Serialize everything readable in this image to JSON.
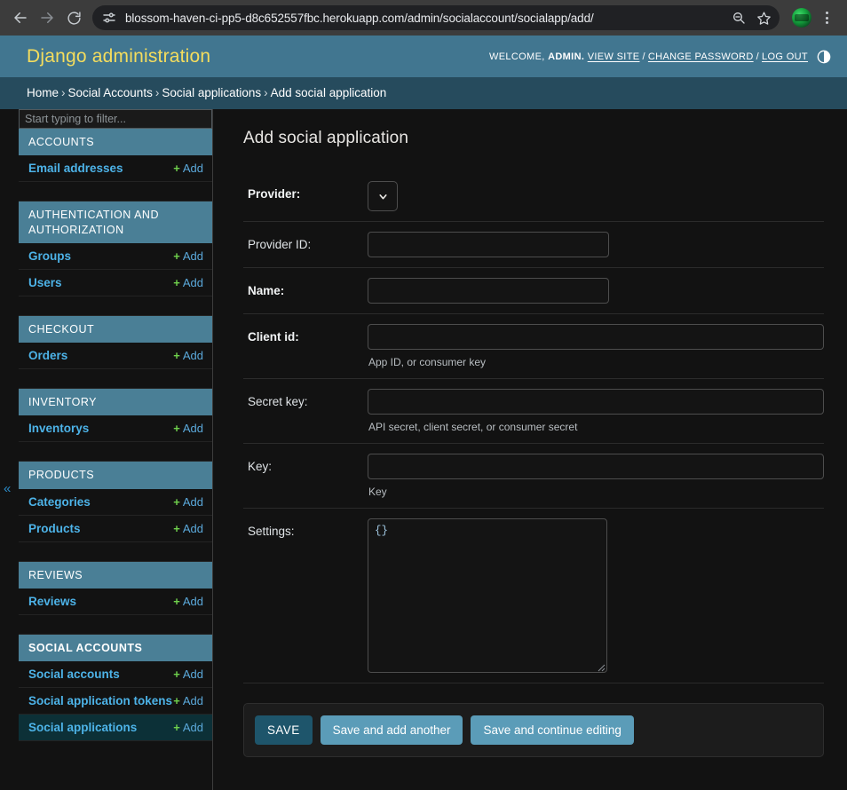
{
  "browser": {
    "url": "blossom-haven-ci-pp5-d8c652557fbc.herokuapp.com/admin/socialaccount/socialapp/add/",
    "back_icon": "back-arrow-icon",
    "forward_icon": "forward-arrow-icon",
    "reload_icon": "reload-icon",
    "site_info_icon": "site-settings-icon",
    "zoom_icon": "zoom-out-icon",
    "bookmark_icon": "star-icon",
    "profile_icon": "profile-avatar",
    "menu_icon": "kebab-menu-icon"
  },
  "header": {
    "brand": "Django administration",
    "welcome_prefix": "WELCOME,",
    "username": "ADMIN.",
    "view_site": "VIEW SITE",
    "change_password": "CHANGE PASSWORD",
    "log_out": "LOG OUT",
    "separator": "/",
    "theme_toggle_icon": "theme-toggle-icon",
    "bg_color": "#417690",
    "brand_color": "#f5dd5d"
  },
  "breadcrumbs": {
    "items": [
      "Home",
      "Social Accounts",
      "Social applications",
      "Add social application"
    ],
    "separator": "›",
    "bg_color": "#264b5d"
  },
  "sidebar": {
    "filter_placeholder": "Start typing to filter...",
    "filter_value": "",
    "collapse_icon": "«",
    "add_label": "Add",
    "plus_glyph": "+",
    "groups": [
      {
        "caption": "ACCOUNTS",
        "bold": false,
        "models": [
          {
            "label": "Email addresses",
            "add": "Add",
            "current": false
          }
        ]
      },
      {
        "caption": "AUTHENTICATION AND AUTHORIZATION",
        "bold": false,
        "models": [
          {
            "label": "Groups",
            "add": "Add",
            "current": false
          },
          {
            "label": "Users",
            "add": "Add",
            "current": false
          }
        ]
      },
      {
        "caption": "CHECKOUT",
        "bold": false,
        "models": [
          {
            "label": "Orders",
            "add": "Add",
            "current": false
          }
        ]
      },
      {
        "caption": "INVENTORY",
        "bold": false,
        "models": [
          {
            "label": "Inventorys",
            "add": "Add",
            "current": false
          }
        ]
      },
      {
        "caption": "PRODUCTS",
        "bold": false,
        "models": [
          {
            "label": "Categories",
            "add": "Add",
            "current": false
          },
          {
            "label": "Products",
            "add": "Add",
            "current": false
          }
        ]
      },
      {
        "caption": "REVIEWS",
        "bold": false,
        "models": [
          {
            "label": "Reviews",
            "add": "Add",
            "current": false
          }
        ]
      },
      {
        "caption": "SOCIAL ACCOUNTS",
        "bold": true,
        "models": [
          {
            "label": "Social accounts",
            "add": "Add",
            "current": false
          },
          {
            "label": "Social application tokens",
            "add": "Add",
            "current": false
          },
          {
            "label": "Social applications",
            "add": "Add",
            "current": true
          }
        ]
      }
    ],
    "header_bg": "#4a7f96",
    "current_bg": "#0c3037",
    "link_color": "#4db3e8",
    "plus_color": "#6fd04c"
  },
  "main": {
    "title": "Add social application",
    "fields": [
      {
        "label": "Provider:",
        "required": true,
        "control": "select",
        "value": "",
        "help": "",
        "chevron_icon": "chevron-down-icon"
      },
      {
        "label": "Provider ID:",
        "required": false,
        "control": "text-narrow",
        "value": "",
        "help": ""
      },
      {
        "label": "Name:",
        "required": true,
        "control": "text-narrow",
        "value": "",
        "help": ""
      },
      {
        "label": "Client id:",
        "required": true,
        "control": "text-wide",
        "value": "",
        "help": "App ID, or consumer key"
      },
      {
        "label": "Secret key:",
        "required": false,
        "control": "text-wide",
        "value": "",
        "help": "API secret, client secret, or consumer secret"
      },
      {
        "label": "Key:",
        "required": false,
        "control": "text-wide",
        "value": "",
        "help": "Key"
      },
      {
        "label": "Settings:",
        "required": false,
        "control": "textarea",
        "value": "{}",
        "help": ""
      }
    ],
    "buttons": {
      "save": "SAVE",
      "save_and_add_another": "Save and add another",
      "save_and_continue": "Save and continue editing"
    },
    "accent_default": "#5b9cb8",
    "accent_primary": "#1e556b"
  }
}
